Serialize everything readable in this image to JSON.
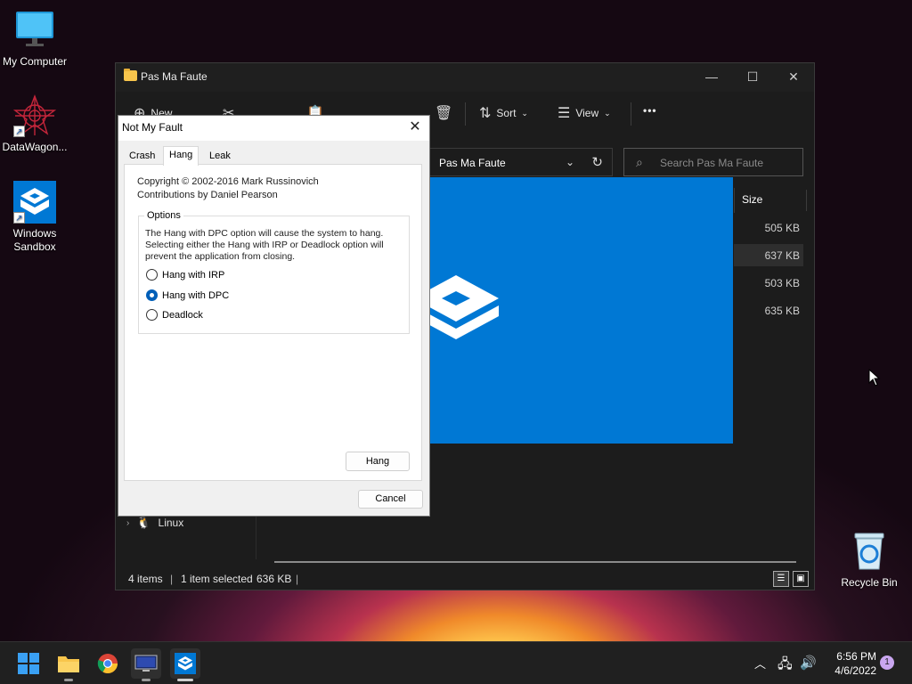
{
  "desktop": {
    "icons": [
      {
        "label": "My Computer"
      },
      {
        "label": "DataWagon..."
      },
      {
        "label": "Windows Sandbox"
      }
    ],
    "recycle_bin": "Recycle Bin"
  },
  "explorer": {
    "title": "Pas Ma Faute",
    "toolbar": {
      "new": "New",
      "sort": "Sort",
      "view": "View",
      "more": "•••"
    },
    "address": "Pas Ma Faute",
    "search_placeholder": "Search Pas Ma Faute",
    "columns": {
      "size": "Size"
    },
    "sizes": [
      "505 KB",
      "637 KB",
      "503 KB",
      "635 KB"
    ],
    "nav": {
      "linux": "Linux"
    },
    "status": {
      "items": "4 items",
      "selected": "1 item selected",
      "selected_size": "636 KB"
    }
  },
  "dialog": {
    "title": "Not My Fault",
    "tabs": [
      "Crash",
      "Hang",
      "Leak"
    ],
    "active_tab": "Hang",
    "copyright": "Copyright © 2002-2016 Mark Russinovich",
    "contributions": "Contributions by Daniel Pearson",
    "options_legend": "Options",
    "options_text": "The Hang with DPC option will cause the system to hang. Selecting either the Hang with IRP or Deadlock option will prevent the application from closing.",
    "radios": [
      {
        "label": "Hang with IRP",
        "selected": false
      },
      {
        "label": "Hang with DPC",
        "selected": true
      },
      {
        "label": "Deadlock",
        "selected": false
      }
    ],
    "hang_button": "Hang",
    "cancel_button": "Cancel"
  },
  "taskbar": {
    "time": "6:56 PM",
    "date": "4/6/2022",
    "notifications": "1"
  },
  "colors": {
    "accent": "#0078d4",
    "radio_selected": "#005fb8"
  }
}
